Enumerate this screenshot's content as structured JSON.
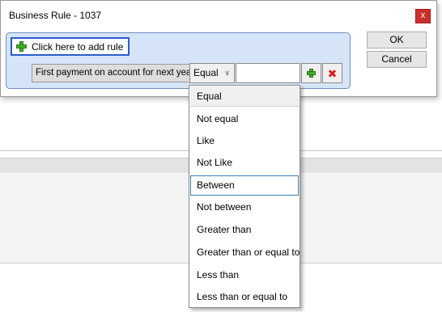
{
  "dialog": {
    "title": "Business Rule - 1037",
    "close_label": "x",
    "ok_label": "OK",
    "cancel_label": "Cancel"
  },
  "rule": {
    "add_rule_label": "Click here to add rule",
    "field": "First payment on account for next year",
    "operator": "Equal",
    "value": ""
  },
  "dropdown": {
    "options": [
      {
        "label": "Equal",
        "state": "selected"
      },
      {
        "label": "Not equal",
        "state": ""
      },
      {
        "label": "Like",
        "state": ""
      },
      {
        "label": "Not Like",
        "state": ""
      },
      {
        "label": "Between",
        "state": "hover"
      },
      {
        "label": "Not between",
        "state": ""
      },
      {
        "label": "Greater than",
        "state": ""
      },
      {
        "label": "Greater than or equal to",
        "state": ""
      },
      {
        "label": "Less than",
        "state": ""
      },
      {
        "label": "Less than or equal to",
        "state": ""
      }
    ]
  },
  "colors": {
    "panel_bg": "#d6e4f7",
    "accent_border": "#2b5ccc",
    "close_bg": "#c9302c",
    "add_green": "#3fae2a",
    "remove_red": "#d62020"
  }
}
